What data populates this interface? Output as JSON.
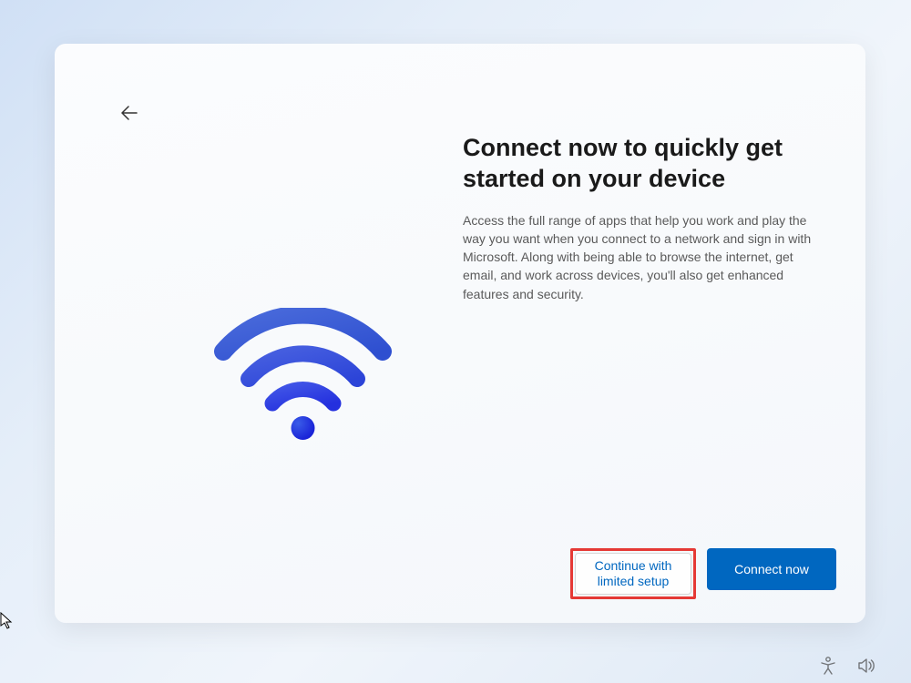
{
  "header": {
    "title": "Connect now to quickly get started on your device"
  },
  "body": {
    "description": "Access the full range of apps that help you work and play the way you want when you connect to a network and sign in with Microsoft. Along with being able to browse the internet, get email, and work across devices, you'll also get enhanced features and security."
  },
  "actions": {
    "secondary_label": "Continue with limited setup",
    "primary_label": "Connect now"
  },
  "colors": {
    "accent": "#0067c0",
    "highlight": "#e53935"
  }
}
